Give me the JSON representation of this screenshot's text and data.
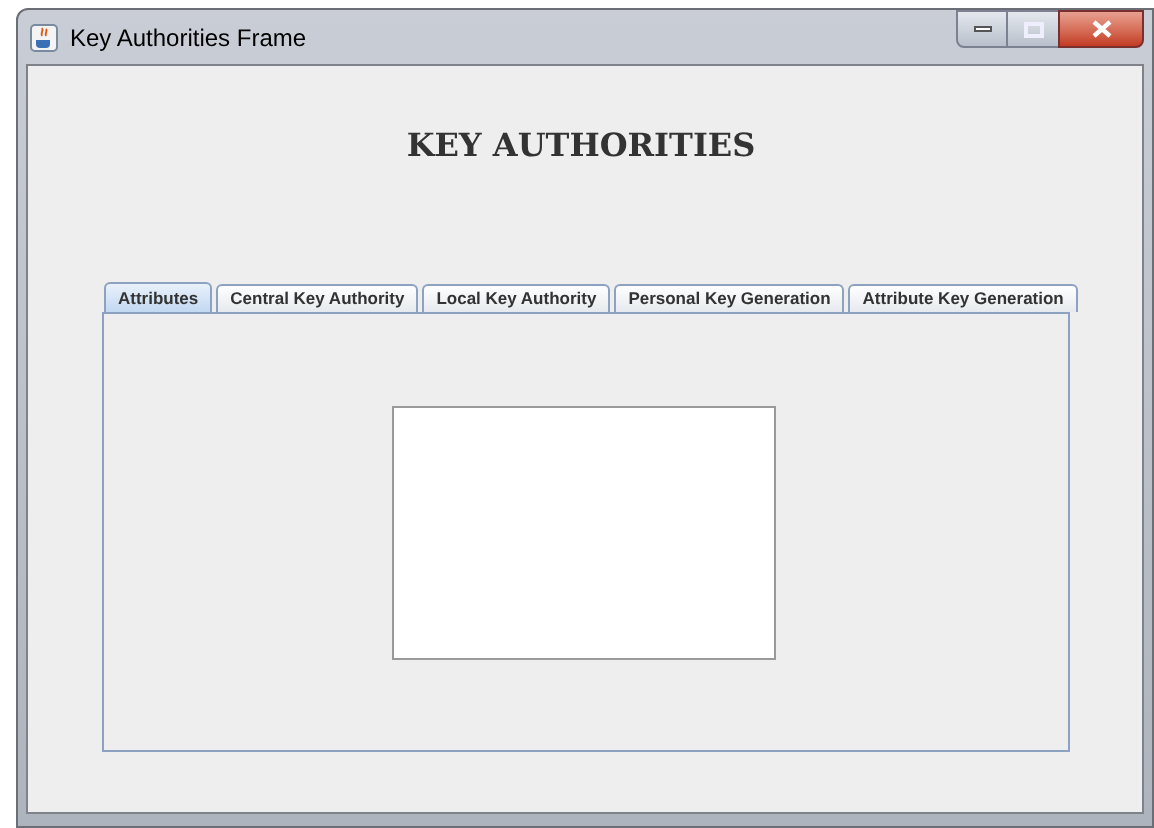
{
  "window": {
    "title": "Key Authorities Frame"
  },
  "heading": "KEY AUTHORITIES",
  "tabs": [
    {
      "label": "Attributes",
      "selected": true
    },
    {
      "label": "Central Key Authority",
      "selected": false
    },
    {
      "label": "Local Key Authority",
      "selected": false
    },
    {
      "label": "Personal Key Generation",
      "selected": false
    },
    {
      "label": "Attribute Key Generation",
      "selected": false
    }
  ]
}
